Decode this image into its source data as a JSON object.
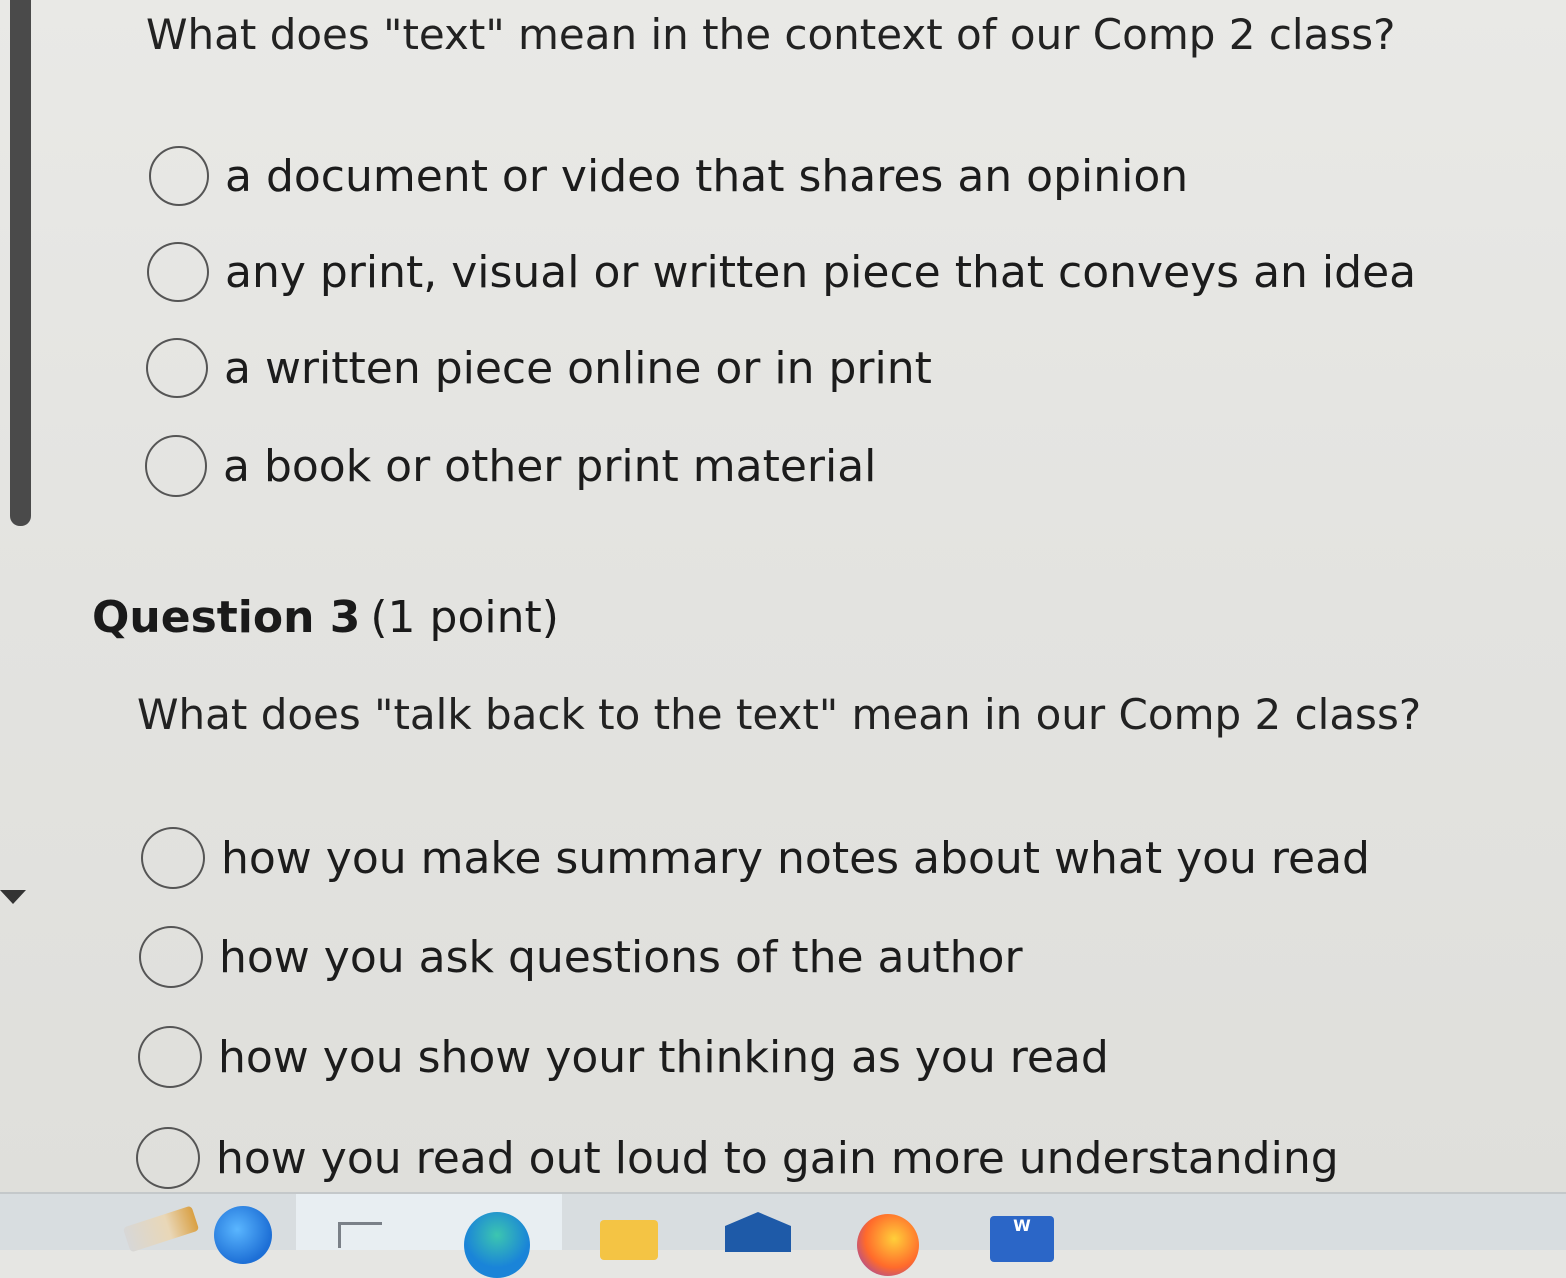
{
  "question2": {
    "prompt": "What does \"text\" mean in the context of our Comp 2 class?",
    "options": [
      {
        "label": "a document or video that shares an opinion",
        "selected": false
      },
      {
        "label": "any print, visual or written piece that conveys an idea",
        "selected": false
      },
      {
        "label": "a written piece online or in print",
        "selected": false
      },
      {
        "label": "a book or other print material",
        "selected": false
      }
    ]
  },
  "question3": {
    "number_label": "Question 3",
    "points_label": "(1 point)",
    "prompt": "What does \"talk back to the text\" mean in our Comp 2 class?",
    "options": [
      {
        "label": "how you make summary notes about what you read",
        "selected": false
      },
      {
        "label": "how you ask questions of the author",
        "selected": false
      },
      {
        "label": "how you show your thinking as you read",
        "selected": false
      },
      {
        "label": "how you read out loud to gain more understanding",
        "selected": false
      }
    ]
  },
  "taskbar": {
    "icons": [
      "pencil-icon",
      "globe-icon",
      "task-view-icon",
      "edge-icon",
      "folder-icon",
      "mail-icon",
      "firefox-icon",
      "word-icon"
    ],
    "word_letter": "W"
  }
}
